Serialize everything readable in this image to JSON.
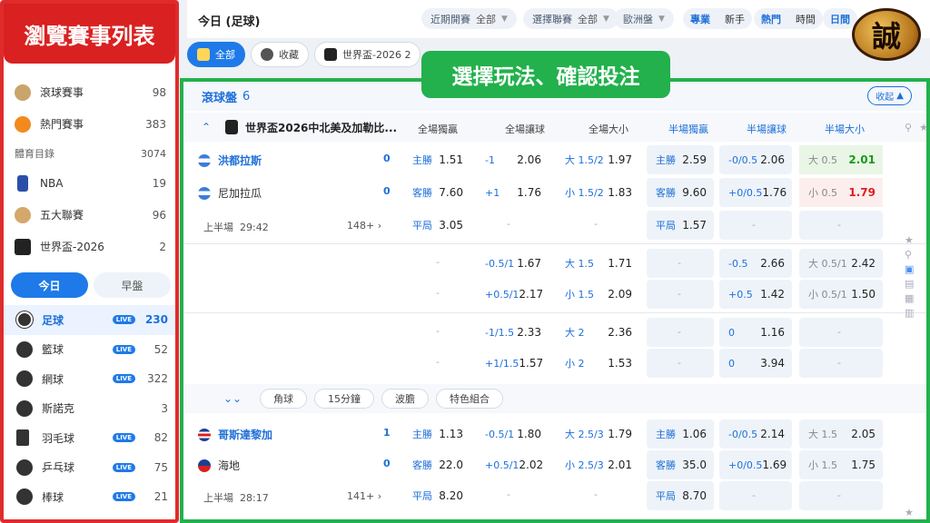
{
  "sidebar": {
    "banner": "瀏覽賽事列表",
    "items": [
      {
        "label": "滾球賽事",
        "count": "98",
        "icon": "soccer-ball-icon"
      },
      {
        "label": "熱門賽事",
        "count": "383",
        "icon": "fire-icon"
      }
    ],
    "catalog": {
      "label": "體育目錄",
      "count": "3074"
    },
    "leagues": [
      {
        "label": "NBA",
        "count": "19",
        "icon": "nba-icon"
      },
      {
        "label": "五大聯賽",
        "count": "96",
        "icon": "league-icon"
      },
      {
        "label": "世界盃-2026",
        "count": "2",
        "icon": "worldcup-icon"
      }
    ],
    "tabs": [
      "今日",
      "早盤"
    ],
    "sports": [
      {
        "label": "足球",
        "live": "LIVE",
        "count": "230",
        "selected": true
      },
      {
        "label": "籃球",
        "live": "LIVE",
        "count": "52"
      },
      {
        "label": "網球",
        "live": "LIVE",
        "count": "322"
      },
      {
        "label": "斯諾克",
        "live": "",
        "count": "3"
      },
      {
        "label": "羽毛球",
        "live": "LIVE",
        "count": "82"
      },
      {
        "label": "乒乓球",
        "live": "LIVE",
        "count": "75"
      },
      {
        "label": "棒球",
        "live": "LIVE",
        "count": "21"
      }
    ]
  },
  "topbar": {
    "title": "今日 (足球)",
    "sort": {
      "label": "近期開賽",
      "value": "全部"
    },
    "league": {
      "label": "選擇聯賽",
      "value": "全部"
    },
    "odds": {
      "label": "歐洲盤"
    },
    "mode": [
      "專業",
      "新手"
    ],
    "view": [
      "熱門",
      "時間"
    ],
    "date": "日間"
  },
  "logo_text": "誠",
  "filters": [
    "全部",
    "收藏",
    "世界盃-2026 2"
  ],
  "banner": "選擇玩法、確認投注",
  "section": {
    "title": "滾球盤",
    "count": "6",
    "collapse": "收起"
  },
  "match1": {
    "league": "世界盃2026中北美及加勒比...",
    "columns": [
      "全場獨贏",
      "全場讓球",
      "全場大小",
      "半場獨贏",
      "半場讓球",
      "半場大小"
    ],
    "home": "洪都拉斯",
    "home_score": "0",
    "away": "尼加拉瓜",
    "away_score": "0",
    "period": "上半場",
    "time": "29:42",
    "more": "148+",
    "r1": [
      "主勝",
      "1.51",
      "-1",
      "2.06",
      "大 1.5/2",
      "1.97",
      "主勝",
      "2.59",
      "-0/0.5",
      "2.06",
      "大 0.5",
      "2.01"
    ],
    "r2": [
      "客勝",
      "7.60",
      "+1",
      "1.76",
      "小 1.5/2",
      "1.83",
      "客勝",
      "9.60",
      "+0/0.5",
      "1.76",
      "小 0.5",
      "1.79"
    ],
    "r3": [
      "平局",
      "3.05",
      "平局",
      "1.57"
    ],
    "r4": [
      "-0.5/1",
      "1.67",
      "大 1.5",
      "1.71",
      "-0.5",
      "2.66",
      "大 0.5/1",
      "2.42"
    ],
    "r5": [
      "+0.5/1",
      "2.17",
      "小 1.5",
      "2.09",
      "+0.5",
      "1.42",
      "小 0.5/1",
      "1.50"
    ],
    "r6": [
      "-1/1.5",
      "2.33",
      "大 2",
      "2.36",
      "0",
      "1.16"
    ],
    "r7": [
      "+1/1.5",
      "1.57",
      "小 2",
      "1.53",
      "0",
      "3.94"
    ],
    "tabs": [
      "角球",
      "15分鐘",
      "波膽",
      "特色組合"
    ]
  },
  "match2": {
    "home": "哥斯達黎加",
    "home_score": "1",
    "away": "海地",
    "away_score": "0",
    "period": "上半場",
    "time": "28:17",
    "more": "141+",
    "r1": [
      "主勝",
      "1.13",
      "-0.5/1",
      "1.80",
      "大 2.5/3",
      "1.79",
      "主勝",
      "1.06",
      "-0/0.5",
      "2.14",
      "大 1.5",
      "2.05"
    ],
    "r2": [
      "客勝",
      "22.0",
      "+0.5/1",
      "2.02",
      "小 2.5/3",
      "2.01",
      "客勝",
      "35.0",
      "+0/0.5",
      "1.69",
      "小 1.5",
      "1.75"
    ],
    "r3": [
      "平局",
      "8.20",
      "平局",
      "8.70"
    ]
  },
  "dash": "-"
}
